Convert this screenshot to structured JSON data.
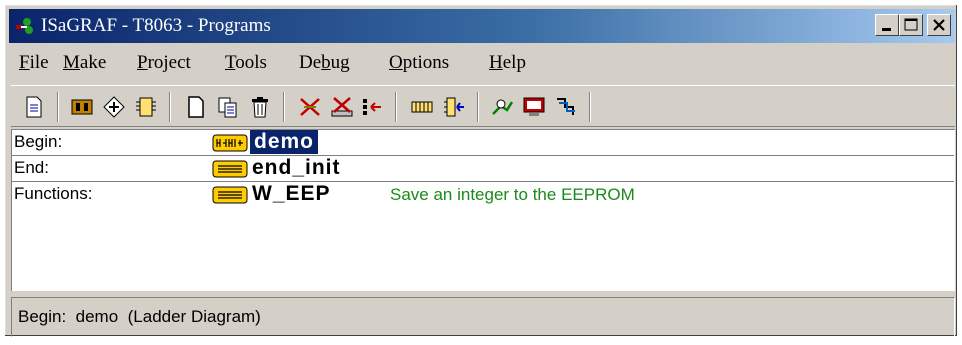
{
  "window": {
    "title": "ISaGRAF - T8063 - Programs",
    "controls": [
      "minimize-button",
      "maximize-button",
      "close-button"
    ]
  },
  "menu": {
    "items": [
      {
        "accel": "F",
        "rest": "ile"
      },
      {
        "accel": "M",
        "rest": "ake"
      },
      {
        "accel": "P",
        "rest": "roject"
      },
      {
        "accel": "T",
        "rest": "ools"
      },
      {
        "pre": "De",
        "accel": "b",
        "rest": "ug"
      },
      {
        "accel": "O",
        "rest": "ptions"
      },
      {
        "accel": "H",
        "rest": "elp"
      }
    ]
  },
  "toolbar": {
    "icons": [
      "document-icon",
      "dictionary-icon",
      "network-icon",
      "io-icon",
      "new-program-icon",
      "copy-icon",
      "delete-icon",
      "compile-icon",
      "verify-icon",
      "link-icon",
      "simulate-icon",
      "debug-icon",
      "connect-icon",
      "monitor-icon",
      "download-icon"
    ]
  },
  "programs": {
    "begin": {
      "label": "Begin:",
      "name": "demo",
      "icon": "ladder-diagram-icon"
    },
    "end": {
      "label": "End:",
      "name": "end_init",
      "icon": "structured-text-icon"
    },
    "functions": {
      "label": "Functions:",
      "name": "W_EEP",
      "description": "Save an integer to the EEPROM",
      "icon": "structured-text-icon"
    }
  },
  "status": {
    "text": "Begin:  demo  (Ladder Diagram)"
  },
  "colors": {
    "titlebar_start": "#0a246a",
    "titlebar_end": "#a6caf0",
    "selection": "#0a246a",
    "description": "#1a8a1a",
    "chrome": "#d4d0c8"
  }
}
